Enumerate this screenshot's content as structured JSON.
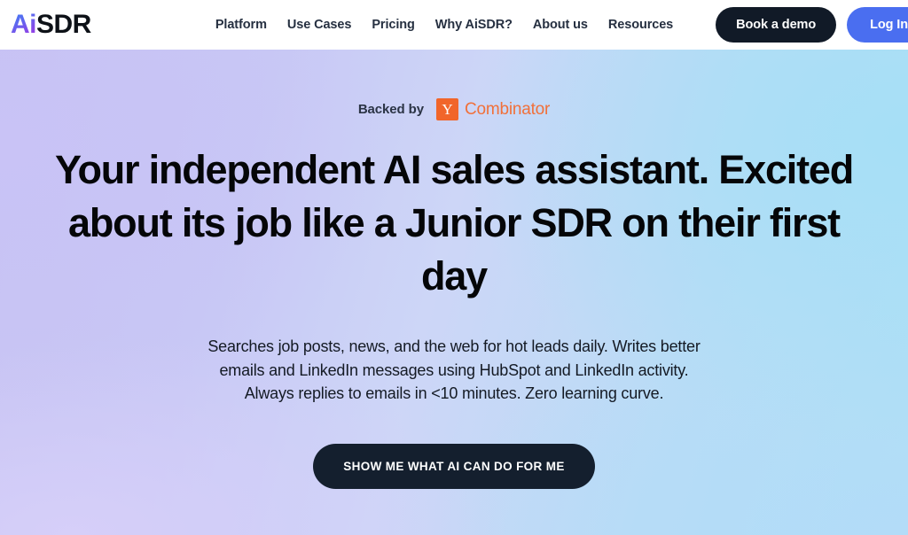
{
  "header": {
    "logo": {
      "prefix": "Ai",
      "suffix": "SDR"
    },
    "nav": [
      {
        "label": "Platform"
      },
      {
        "label": "Use Cases"
      },
      {
        "label": "Pricing"
      },
      {
        "label": "Why AiSDR?"
      },
      {
        "label": "About us"
      },
      {
        "label": "Resources"
      }
    ],
    "demo_button": "Book a demo",
    "login_button": "Log In"
  },
  "hero": {
    "backed_by_label": "Backed by",
    "yc_mark": "Y",
    "yc_name": "Combinator",
    "headline": "Your independent AI sales assistant. Excited about its job like a Junior SDR on their first day",
    "subtitle": "Searches job posts, news, and the web for hot leads daily. Writes better emails and LinkedIn messages using HubSpot and LinkedIn activity. Always replies to emails in <10 minutes. Zero learning curve.",
    "cta_label": "SHOW ME WHAT AI CAN DO FOR ME"
  },
  "colors": {
    "accent_blue": "#4a6ef0",
    "dark_navy": "#111a27",
    "yc_orange": "#f1652a",
    "logo_gradient_start": "#3d7df5",
    "logo_gradient_end": "#a03fe0",
    "hero_gradient_left": "#c6c2f2",
    "hero_gradient_right": "#aee0f5"
  }
}
